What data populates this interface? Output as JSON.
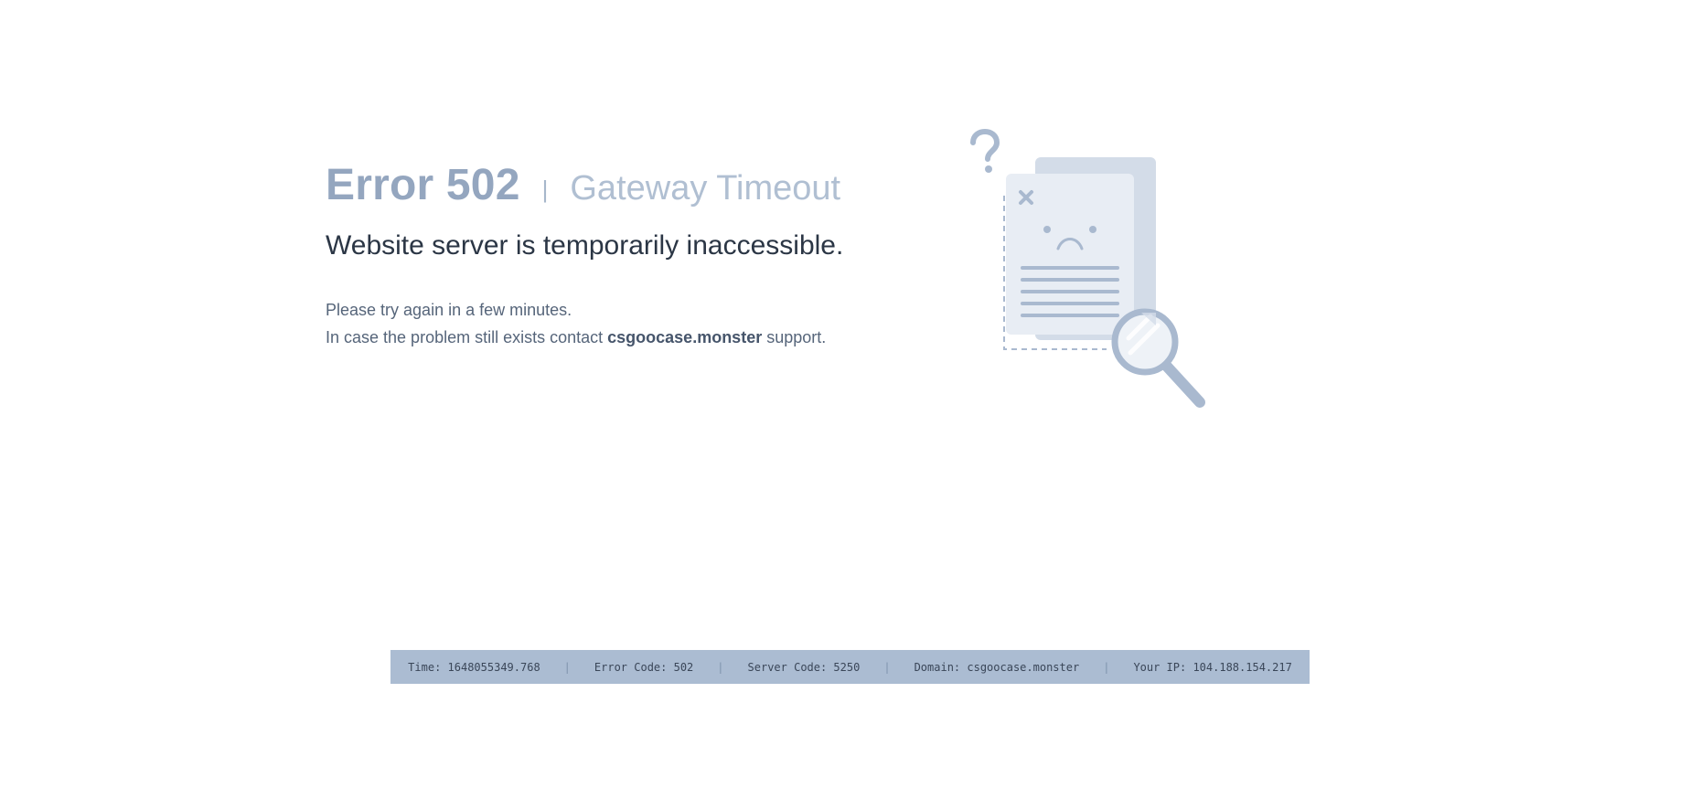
{
  "error": {
    "code_label": "Error 502",
    "separator": "|",
    "name": "Gateway Timeout"
  },
  "headline": "Website server is temporarily inaccessible.",
  "message": {
    "line1": "Please try again in a few minutes.",
    "line2_prefix": "In case the problem still exists contact ",
    "line2_domain": "csgoocase.monster",
    "line2_suffix": " support."
  },
  "illustration": {
    "icons": [
      "question-mark-icon",
      "document-icon",
      "close-icon",
      "sad-face-icon",
      "magnifier-icon"
    ],
    "color_light": "#e8edf4",
    "color_mid": "#d3dce8",
    "color_dark": "#a9b9cf"
  },
  "footer": {
    "time": "Time: 1648055349.768",
    "error_code": "Error Code: 502",
    "server_code": "Server Code: 5250",
    "domain": "Domain: csgoocase.monster",
    "ip": "Your IP: 104.188.154.217",
    "separator": "|"
  },
  "colors": {
    "footer_bg": "#abbcd2",
    "heading_muted": "#94a6bf",
    "text_dark": "#2b3645"
  }
}
